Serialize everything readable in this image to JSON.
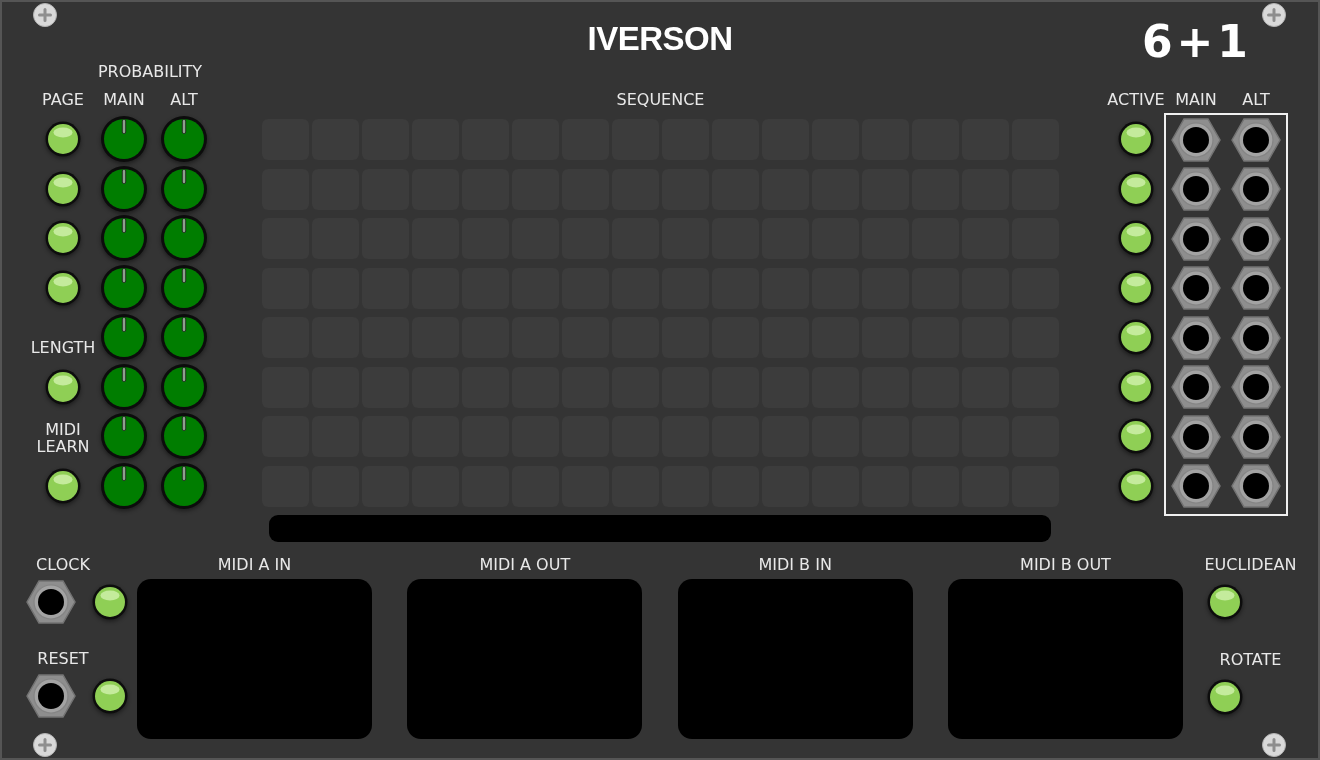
{
  "title": "IVERSON",
  "logo": "6+1",
  "left_column": {
    "header": "PAGE",
    "cells": [
      {
        "kind": "button",
        "lit": true
      },
      {
        "kind": "button",
        "lit": true
      },
      {
        "kind": "button",
        "lit": true
      },
      {
        "kind": "button",
        "lit": true
      },
      {
        "kind": "label",
        "text": "LENGTH"
      },
      {
        "kind": "button",
        "lit": true
      },
      {
        "kind": "label",
        "text": "MIDI LEARN"
      },
      {
        "kind": "button",
        "lit": true
      }
    ]
  },
  "probability": {
    "title": "PROBABILITY",
    "columns": [
      {
        "label": "MAIN"
      },
      {
        "label": "ALT"
      }
    ]
  },
  "sequence": {
    "label": "SEQUENCE",
    "rows": [
      {
        "steps": [
          {
            "on": false
          },
          {
            "on": false
          },
          {
            "on": false
          },
          {
            "on": false
          },
          {
            "on": false
          },
          {
            "on": false
          },
          {
            "on": false
          },
          {
            "on": false
          },
          {
            "on": false
          },
          {
            "on": false
          },
          {
            "on": false
          },
          {
            "on": false
          },
          {
            "on": false
          },
          {
            "on": false
          },
          {
            "on": false
          },
          {
            "on": false
          }
        ]
      },
      {
        "steps": [
          {
            "on": false
          },
          {
            "on": false
          },
          {
            "on": false
          },
          {
            "on": false
          },
          {
            "on": false
          },
          {
            "on": false
          },
          {
            "on": false
          },
          {
            "on": false
          },
          {
            "on": false
          },
          {
            "on": false
          },
          {
            "on": false
          },
          {
            "on": false
          },
          {
            "on": false
          },
          {
            "on": false
          },
          {
            "on": false
          },
          {
            "on": false
          }
        ]
      },
      {
        "steps": [
          {
            "on": false
          },
          {
            "on": false
          },
          {
            "on": false
          },
          {
            "on": false
          },
          {
            "on": false
          },
          {
            "on": false
          },
          {
            "on": false
          },
          {
            "on": false
          },
          {
            "on": false
          },
          {
            "on": false
          },
          {
            "on": false
          },
          {
            "on": false
          },
          {
            "on": false
          },
          {
            "on": false
          },
          {
            "on": false
          },
          {
            "on": false
          }
        ]
      },
      {
        "steps": [
          {
            "on": false
          },
          {
            "on": false
          },
          {
            "on": false
          },
          {
            "on": false
          },
          {
            "on": false
          },
          {
            "on": false
          },
          {
            "on": false
          },
          {
            "on": false
          },
          {
            "on": false
          },
          {
            "on": false
          },
          {
            "on": false
          },
          {
            "on": false
          },
          {
            "on": false
          },
          {
            "on": false
          },
          {
            "on": false
          },
          {
            "on": false
          }
        ]
      },
      {
        "steps": [
          {
            "on": false
          },
          {
            "on": false
          },
          {
            "on": false
          },
          {
            "on": false
          },
          {
            "on": false
          },
          {
            "on": false
          },
          {
            "on": false
          },
          {
            "on": false
          },
          {
            "on": false
          },
          {
            "on": false
          },
          {
            "on": false
          },
          {
            "on": false
          },
          {
            "on": false
          },
          {
            "on": false
          },
          {
            "on": false
          },
          {
            "on": false
          }
        ]
      },
      {
        "steps": [
          {
            "on": false
          },
          {
            "on": false
          },
          {
            "on": false
          },
          {
            "on": false
          },
          {
            "on": false
          },
          {
            "on": false
          },
          {
            "on": false
          },
          {
            "on": false
          },
          {
            "on": false
          },
          {
            "on": false
          },
          {
            "on": false
          },
          {
            "on": false
          },
          {
            "on": false
          },
          {
            "on": false
          },
          {
            "on": false
          },
          {
            "on": false
          }
        ]
      },
      {
        "steps": [
          {
            "on": false
          },
          {
            "on": false
          },
          {
            "on": false
          },
          {
            "on": false
          },
          {
            "on": false
          },
          {
            "on": false
          },
          {
            "on": false
          },
          {
            "on": false
          },
          {
            "on": false
          },
          {
            "on": false
          },
          {
            "on": false
          },
          {
            "on": false
          },
          {
            "on": false
          },
          {
            "on": false
          },
          {
            "on": false
          },
          {
            "on": false
          }
        ]
      },
      {
        "steps": [
          {
            "on": false
          },
          {
            "on": false
          },
          {
            "on": false
          },
          {
            "on": false
          },
          {
            "on": false
          },
          {
            "on": false
          },
          {
            "on": false
          },
          {
            "on": false
          },
          {
            "on": false
          },
          {
            "on": false
          },
          {
            "on": false
          },
          {
            "on": false
          },
          {
            "on": false
          },
          {
            "on": false
          },
          {
            "on": false
          },
          {
            "on": false
          }
        ]
      }
    ]
  },
  "active": {
    "label": "ACTIVE",
    "buttons": [
      {
        "lit": true
      },
      {
        "lit": true
      },
      {
        "lit": true
      },
      {
        "lit": true
      },
      {
        "lit": true
      },
      {
        "lit": true
      },
      {
        "lit": true
      },
      {
        "lit": true
      }
    ]
  },
  "outputs": {
    "columns": [
      {
        "label": "MAIN",
        "jacks": [
          {
            "connected": false
          },
          {
            "connected": false
          },
          {
            "connected": false
          },
          {
            "connected": false
          },
          {
            "connected": false
          },
          {
            "connected": false
          },
          {
            "connected": false
          },
          {
            "connected": false
          }
        ]
      },
      {
        "label": "ALT",
        "jacks": [
          {
            "connected": false
          },
          {
            "connected": false
          },
          {
            "connected": false
          },
          {
            "connected": false
          },
          {
            "connected": false
          },
          {
            "connected": false
          },
          {
            "connected": false
          },
          {
            "connected": false
          }
        ]
      }
    ]
  },
  "inputs": [
    {
      "label": "CLOCK",
      "jack": {
        "connected": false
      },
      "light": {
        "lit": true
      }
    },
    {
      "label": "RESET",
      "jack": {
        "connected": false
      },
      "light": {
        "lit": true
      }
    }
  ],
  "midi_ports": [
    {
      "label": "MIDI A IN"
    },
    {
      "label": "MIDI A OUT"
    },
    {
      "label": "MIDI B IN"
    },
    {
      "label": "MIDI B OUT"
    }
  ],
  "modes": [
    {
      "label": "EUCLIDEAN",
      "button": {
        "lit": true
      }
    },
    {
      "label": "ROTATE",
      "button": {
        "lit": true
      }
    }
  ]
}
